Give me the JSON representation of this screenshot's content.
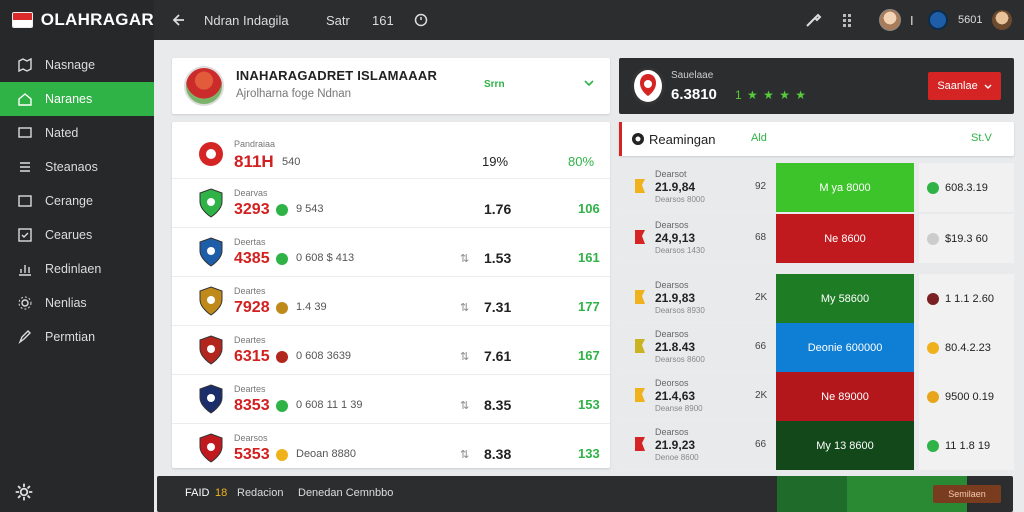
{
  "app": {
    "brand": "OLAHRAGAR"
  },
  "sidebar": {
    "items": [
      {
        "label": "Nasnage",
        "icon": "map-icon",
        "active": false
      },
      {
        "label": "Naranes",
        "icon": "home-icon",
        "active": true
      },
      {
        "label": "Nated",
        "icon": "screen-icon",
        "active": false
      },
      {
        "label": "Steanaos",
        "icon": "settings-icon",
        "active": false
      },
      {
        "label": "Cerange",
        "icon": "folder-icon",
        "active": false
      },
      {
        "label": "Cearues",
        "icon": "checkbox-icon",
        "active": false
      },
      {
        "label": "Redinlaen",
        "icon": "chart-icon",
        "active": false
      },
      {
        "label": "Nenlias",
        "icon": "gear-icon",
        "active": false
      },
      {
        "label": "Permtian",
        "icon": "pen-icon",
        "active": false
      }
    ]
  },
  "topbar": {
    "page_title": "Ndran Indagila",
    "filter": "Satr",
    "count": "161",
    "user_count": "I",
    "score": "5601"
  },
  "header": {
    "title": "INAHARAGADRET ISLAMAAAR",
    "subtitle": "Ajrolharna foge Ndnan",
    "pill": "Srrn"
  },
  "list": {
    "first": {
      "label": "Pandraiaa",
      "score": "811H",
      "detail": "540",
      "v1": "19%",
      "v2": "80%"
    },
    "rows": [
      {
        "label": "Dearvas",
        "score": "3293",
        "dot": "#2fb246",
        "detail": "9 543",
        "v1": "1.76",
        "v2": "106"
      },
      {
        "label": "Deertas",
        "score": "4385",
        "dot": "#2fb246",
        "detail": "0 608 $ 413",
        "v1": "1.53",
        "v2": "161"
      },
      {
        "label": "Deartes",
        "score": "7928",
        "dot": "#c08a1a",
        "detail": "1.4 39",
        "v1": "7.31",
        "v2": "177"
      },
      {
        "label": "Deartes",
        "score": "6315",
        "dot": "#b3261e",
        "detail": "0 608 3639",
        "v1": "7.61",
        "v2": "167"
      },
      {
        "label": "Deartes",
        "score": "8353",
        "dot": "#2fb246",
        "detail": "0 608 11 1 39",
        "v1": "8.35",
        "v2": "153"
      },
      {
        "label": "Dearsos",
        "score": "5353",
        "dot": "#f0b21c",
        "detail": "Deoan 8880",
        "v1": "8.38",
        "v2": "133"
      }
    ]
  },
  "right_head": {
    "label": "Sauelaae",
    "value": "6.3810",
    "stars": "1 ★ ★ ★ ★",
    "button": "Saanlae"
  },
  "right_table": {
    "title": "Reamingan",
    "mid": "Ald",
    "right": "St.V"
  },
  "right_rows": [
    {
      "l1": "Dearsot",
      "l2": "21.9,84",
      "l3": "Dearsos 8000",
      "mid": "92",
      "bar_text": "M ya 8000",
      "bar_color": "#3cc42a",
      "circle": "#2fb246",
      "tail": "608.3.19",
      "icon_color": "#f0b21c"
    },
    {
      "l1": "Dearsos",
      "l2": "24,9,13",
      "l3": "Dearsos 1430",
      "mid": "68",
      "bar_text": "Ne 8600",
      "bar_color": "#c0191e",
      "circle": "#cccccc",
      "tail": "$19.3 60",
      "icon_color": "#d42424"
    },
    {
      "l1": "Dearsos",
      "l2": "21.9,83",
      "l3": "Dearsos 8930",
      "mid": "2K",
      "bar_text": "My 58600",
      "bar_color": "#1d7c24",
      "circle": "#7a1f22",
      "tail": "1 1.1 2.60",
      "icon_color": "#f0b21c"
    },
    {
      "l1": "Dearsos",
      "l2": "21.8.43",
      "l3": "Dearsos 8600",
      "mid": "66",
      "bar_text": "Deonie 600000",
      "bar_color": "#0f7fd6",
      "circle": "#f0b21c",
      "tail": "80.4.2.23",
      "icon_color": "#c9b320"
    },
    {
      "l1": "Deorsos",
      "l2": "21.4,63",
      "l3": "Deanse 8900",
      "mid": "2K",
      "bar_text": "Ne 89000",
      "bar_color": "#b3171b",
      "circle": "#e8a51b",
      "tail": "9500 0.19",
      "icon_color": "#f0b21c"
    },
    {
      "l1": "Dearsos",
      "l2": "21.9,23",
      "l3": "Denoe 8600",
      "mid": "66",
      "bar_text": "My 13 8600",
      "bar_color": "#12481a",
      "circle": "#2fb246",
      "tail": "11 1.8 19",
      "icon_color": "#d42424"
    }
  ],
  "bottom": {
    "a": "FAID",
    "b": "18",
    "c": "Redacion",
    "d": "Denedan Cemnbbo",
    "button": "Semilaen"
  }
}
